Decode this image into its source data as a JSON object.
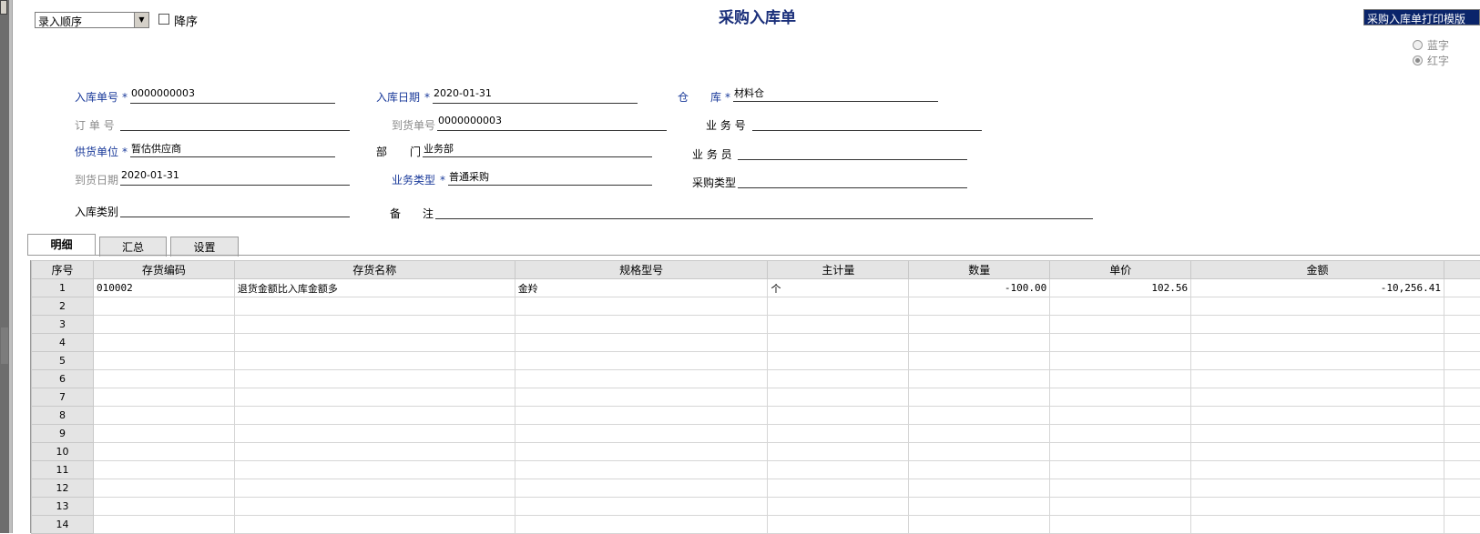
{
  "toolbar": {
    "sort_value": "录入顺序",
    "desc_label": "降序"
  },
  "title": "采购入库单",
  "template": "采购入库单打印模版",
  "color_radio": {
    "blue": "蓝字",
    "red": "红字",
    "selected": "red"
  },
  "form": {
    "receipt_no": {
      "label": "入库单号",
      "req": "*",
      "value": "0000000003"
    },
    "receipt_date": {
      "label": "入库日期",
      "req": "*",
      "value": "2020-01-31"
    },
    "warehouse": {
      "label_a": "仓",
      "label_b": "库",
      "req": "*",
      "value": "材料仓"
    },
    "order_no": {
      "label": "订 单 号",
      "value": ""
    },
    "arrival_no": {
      "label": "到货单号",
      "value": "0000000003"
    },
    "business_no": {
      "label": "业 务 号",
      "value": ""
    },
    "supplier": {
      "label": "供货单位",
      "req": "*",
      "value": "暂估供应商"
    },
    "department": {
      "label_a": "部",
      "label_b": "门",
      "value": "业务部"
    },
    "salesman": {
      "label": "业 务 员",
      "value": ""
    },
    "arrival_date": {
      "label": "到货日期",
      "value": "2020-01-31"
    },
    "business_type": {
      "label": "业务类型",
      "req": "*",
      "value": "普通采购"
    },
    "purchase_type": {
      "label": "采购类型",
      "value": ""
    },
    "receipt_category": {
      "label": "入库类别",
      "value": ""
    },
    "remark": {
      "label_a": "备",
      "label_b": "注",
      "value": ""
    }
  },
  "tabs": [
    "明细",
    "汇总",
    "设置"
  ],
  "grid": {
    "headers": [
      "序号",
      "存货编码",
      "存货名称",
      "规格型号",
      "主计量",
      "数量",
      "单价",
      "金额"
    ],
    "rows": [
      [
        "1",
        "010002",
        "退货金额比入库金额多",
        "金羚",
        "个",
        "-100.00",
        "102.56",
        "-10,256.41"
      ],
      [
        "2",
        "",
        "",
        "",
        "",
        "",
        "",
        ""
      ],
      [
        "3",
        "",
        "",
        "",
        "",
        "",
        "",
        ""
      ],
      [
        "4",
        "",
        "",
        "",
        "",
        "",
        "",
        ""
      ],
      [
        "5",
        "",
        "",
        "",
        "",
        "",
        "",
        ""
      ],
      [
        "6",
        "",
        "",
        "",
        "",
        "",
        "",
        ""
      ],
      [
        "7",
        "",
        "",
        "",
        "",
        "",
        "",
        ""
      ],
      [
        "8",
        "",
        "",
        "",
        "",
        "",
        "",
        ""
      ],
      [
        "9",
        "",
        "",
        "",
        "",
        "",
        "",
        ""
      ],
      [
        "10",
        "",
        "",
        "",
        "",
        "",
        "",
        ""
      ],
      [
        "11",
        "",
        "",
        "",
        "",
        "",
        "",
        ""
      ],
      [
        "12",
        "",
        "",
        "",
        "",
        "",
        "",
        ""
      ],
      [
        "13",
        "",
        "",
        "",
        "",
        "",
        "",
        ""
      ],
      [
        "14",
        "",
        "",
        "",
        "",
        "",
        "",
        ""
      ]
    ]
  }
}
